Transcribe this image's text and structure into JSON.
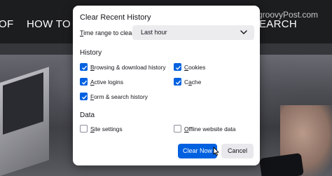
{
  "background": {
    "nav_left_fragment": "OF",
    "nav_how_to": "HOW TO",
    "nav_right_fragment": "EARCH",
    "watermark": "groovyPost.com"
  },
  "dialog": {
    "title": "Clear Recent History",
    "time_range": {
      "label_prefix": "T",
      "label_rest": "ime range to clear:",
      "selected": "Last hour"
    },
    "history": {
      "heading": "History",
      "items": [
        {
          "label_prefix": "",
          "label_accel": "B",
          "label_rest": "rowsing & download history",
          "checked": true
        },
        {
          "label_prefix": "",
          "label_accel": "C",
          "label_rest": "ookies",
          "checked": true
        },
        {
          "label_prefix": "",
          "label_accel": "A",
          "label_rest": "ctive logins",
          "checked": true
        },
        {
          "label_prefix": "C",
          "label_accel": "a",
          "label_rest": "che",
          "checked": true
        },
        {
          "label_prefix": "",
          "label_accel": "F",
          "label_rest": "orm & search history",
          "checked": true
        }
      ]
    },
    "data": {
      "heading": "Data",
      "items": [
        {
          "label_prefix": "",
          "label_accel": "S",
          "label_rest": "ite settings",
          "checked": false
        },
        {
          "label_prefix": "",
          "label_accel": "O",
          "label_rest": "ffline website data",
          "checked": false
        }
      ]
    },
    "buttons": {
      "primary": "Clear Now",
      "secondary": "Cancel"
    }
  },
  "colors": {
    "accent": "#0061e0",
    "dialog_bg": "#ffffff",
    "select_bg": "#ececef"
  },
  "icons": [
    "chevron-down-icon",
    "checkmark-icon",
    "mouse-cursor-icon"
  ]
}
